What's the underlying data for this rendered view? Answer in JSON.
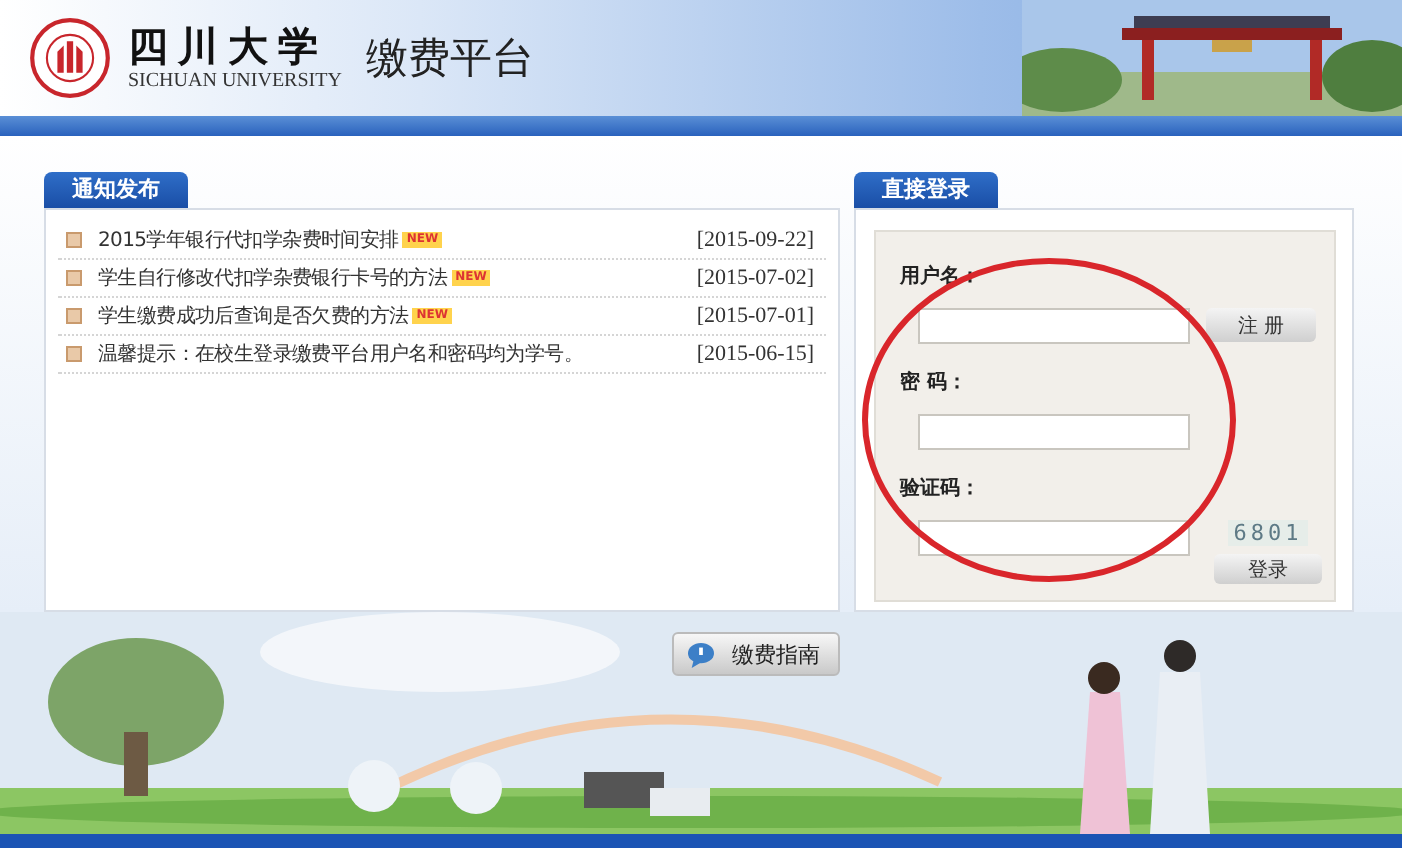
{
  "header": {
    "university_name": "四川大学",
    "university_name_en": "SICHUAN UNIVERSITY",
    "title": "缴费平台"
  },
  "notices": {
    "tab": "通知发布",
    "items": [
      {
        "text": "2015学年银行代扣学杂费时间安排",
        "badge": "NEW",
        "date": "[2015-09-22]"
      },
      {
        "text": "学生自行修改代扣学杂费银行卡号的方法",
        "badge": "NEW",
        "date": "[2015-07-02]"
      },
      {
        "text": "学生缴费成功后查询是否欠费的方法",
        "badge": "NEW",
        "date": "[2015-07-01]"
      },
      {
        "text": "温馨提示：在校生登录缴费平台用户名和密码均为学号。",
        "date": "[2015-06-15]"
      }
    ]
  },
  "login": {
    "tab": "直接登录",
    "fields": [
      {
        "kind": "username",
        "label": "用户名：",
        "button": "注 册"
      },
      {
        "kind": "password",
        "label": "密 码："
      },
      {
        "kind": "captcha",
        "label": "验证码：",
        "captcha": "6801",
        "button": "登录"
      }
    ]
  },
  "guide_button": "缴费指南",
  "annotation": {
    "kind": "circle"
  }
}
